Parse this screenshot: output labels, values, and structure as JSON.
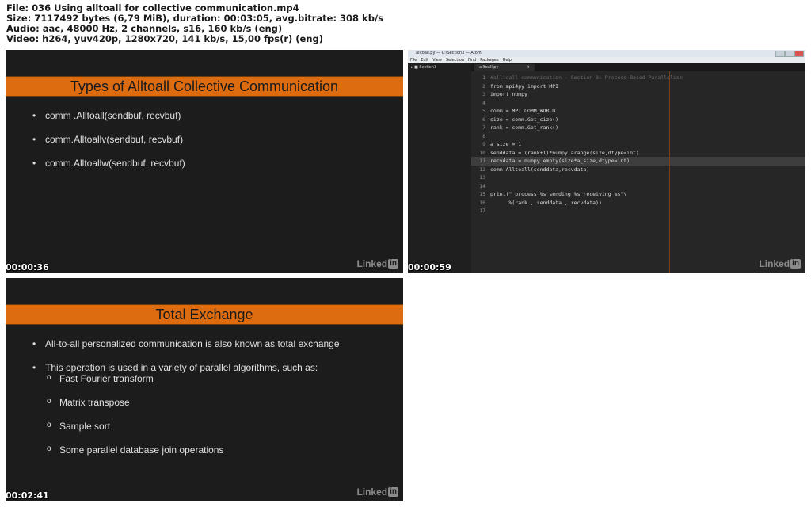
{
  "header": {
    "line1": "File: 036 Using alltoall for collective communication.mp4",
    "line2": "Size: 7117492 bytes (6,79 MiB), duration: 00:03:05, avg.bitrate: 308 kb/s",
    "line3": "Audio: aac, 48000 Hz, 2 channels, s16, 160 kb/s (eng)",
    "line4": "Video: h264, yuv420p, 1280x720, 141 kb/s, 15,00 fps(r) (eng)"
  },
  "brand": {
    "text": "Linked",
    "in": "in"
  },
  "thumb1": {
    "timestamp": "00:00:36",
    "title": "Types of Alltoall Collective Communication",
    "bullets": [
      "comm .Alltoall(sendbuf, recvbuf)",
      "comm.Alltoallv(sendbuf, recvbuf)",
      "comm.Alltoallw(sendbuf, recvbuf)"
    ]
  },
  "thumb2": {
    "timestamp": "00:00:59",
    "window_title": "alltoall.py — C:\\Section3 — Atom",
    "menu": [
      "File",
      "Edit",
      "View",
      "Selection",
      "Find",
      "Packages",
      "Help"
    ],
    "project": "Section3",
    "tab": "alltoall.py",
    "tab_close": "×",
    "line_numbers": [
      "1",
      "2",
      "3",
      "4",
      "5",
      "6",
      "7",
      "8",
      "9",
      "10",
      "11",
      "12",
      "13",
      "14",
      "15",
      "16",
      "17"
    ],
    "code": [
      "#alltoall communication - Section 3: Process Based Parallelism",
      "from mpi4py import MPI",
      "import numpy",
      "",
      "comm = MPI.COMM_WORLD",
      "size = comm.Get_size()",
      "rank = comm.Get_rank()",
      "",
      "a_size = 1",
      "senddata = (rank+1)*numpy.arange(size,dtype=int)",
      "recvdata = numpy.empty(size*a_size,dtype=int)",
      "comm.Alltoall(senddata,recvdata)",
      "",
      "",
      "print(\" process %s sending %s receiving %s\"\\",
      "      %(rank , senddata , recvdata))",
      ""
    ]
  },
  "thumb3": {
    "timestamp": "00:02:41",
    "title": "Total Exchange",
    "bullet1": "All-to-all personalized communication is also known as total exchange",
    "bullet2": "This operation is used in a variety of parallel algorithms, such as:",
    "subs": [
      "Fast Fourier transform",
      "Matrix transpose",
      "Sample sort",
      "Some parallel database join operations"
    ]
  }
}
